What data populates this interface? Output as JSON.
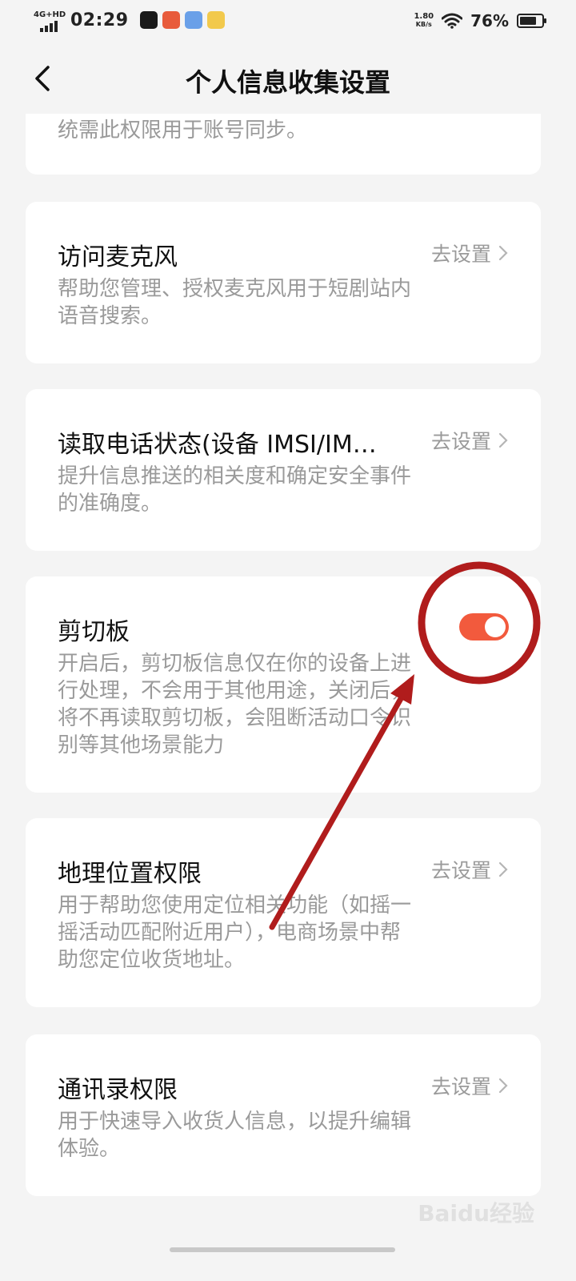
{
  "status_bar": {
    "network_label": "4G+HD",
    "time": "02:29",
    "speed_value": "1.80",
    "speed_unit": "KB/s",
    "battery_percent": "76%",
    "battery_level": 0.76,
    "app_icon_colors": [
      "#1a1a1a",
      "#e85b3b",
      "#6aa0e8",
      "#f2c94c"
    ]
  },
  "header": {
    "title": "个人信息收集设置",
    "back_icon": "chevron-left-icon"
  },
  "cards": {
    "partial": {
      "desc": "统需此权限用于账号同步。"
    },
    "microphone": {
      "title": "访问麦克风",
      "action": "去设置",
      "desc": "帮助您管理、授权麦克风用于短剧站内语音搜索。"
    },
    "phone_state": {
      "title": "读取电话状态(设备 IMSI/IM…",
      "action": "去设置",
      "desc": "提升信息推送的相关度和确定安全事件的准确度。"
    },
    "clipboard": {
      "title": "剪切板",
      "desc": "开启后，剪切板信息仅在你的设备上进行处理，不会用于其他用途，关闭后，将不再读取剪切板，会阻断活动口令识别等其他场景能力",
      "toggle_on": true
    },
    "location": {
      "title": "地理位置权限",
      "action": "去设置",
      "desc": "用于帮助您使用定位相关功能（如摇一摇活动匹配附近用户），电商场景中帮助您定位收货地址。"
    },
    "contacts": {
      "title": "通讯录权限",
      "action": "去设置",
      "desc": "用于快速导入收货人信息，以提升编辑体验。"
    }
  },
  "colors": {
    "toggle_on": "#f25a3d",
    "annotation": "#b01c1c",
    "muted_text": "#9a9a9a"
  },
  "watermark": "Baidu经验"
}
